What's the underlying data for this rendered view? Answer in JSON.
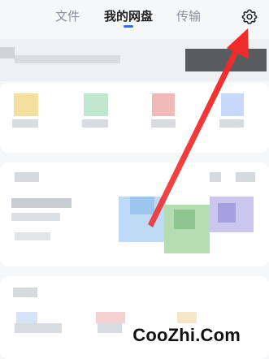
{
  "tabs": [
    {
      "label": "文件"
    },
    {
      "label": "我的网盘"
    },
    {
      "label": "传输"
    }
  ],
  "watermark": "CooZhi.Com",
  "colors": {
    "accent_blue": "#2f6bff",
    "arrow_red": "#ef2b2b"
  }
}
